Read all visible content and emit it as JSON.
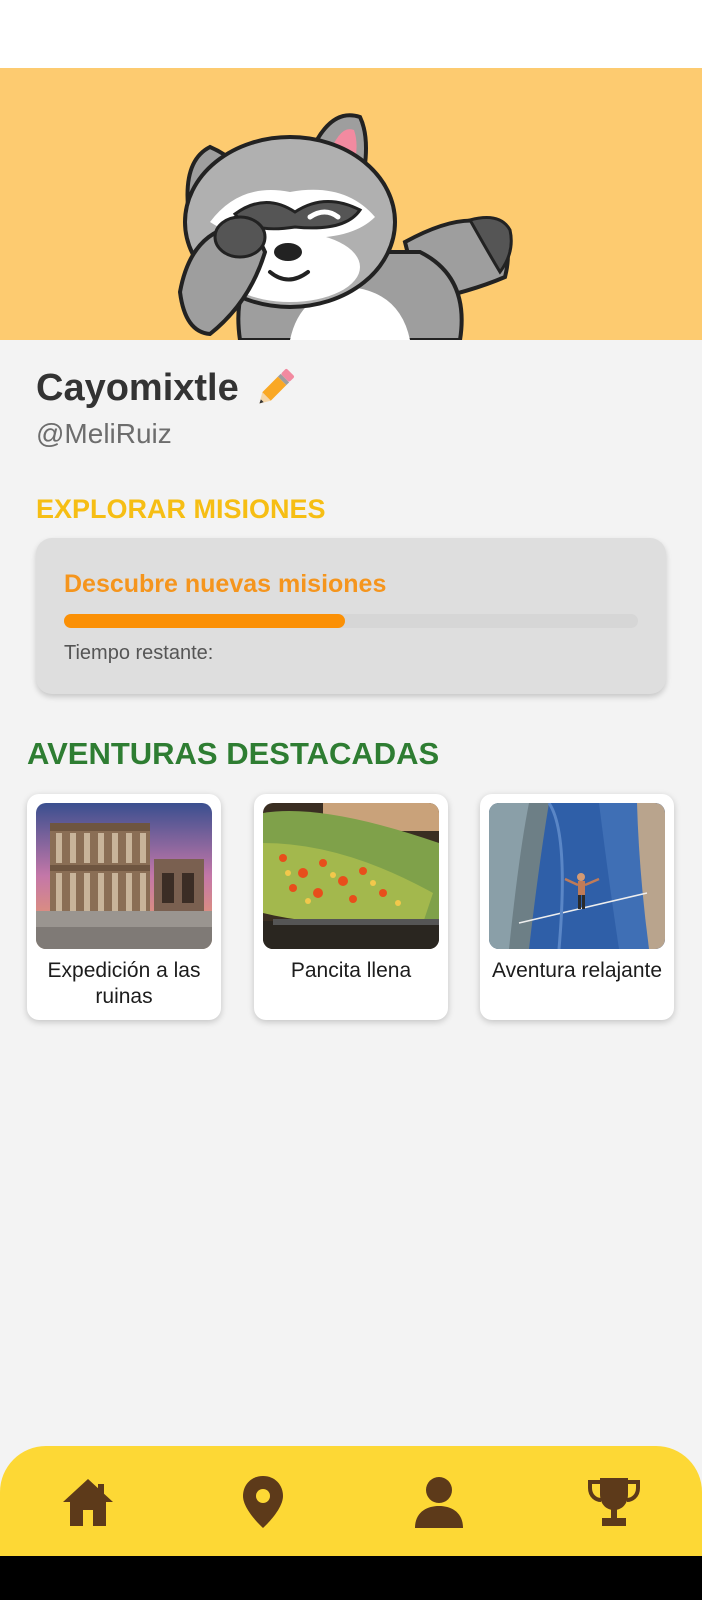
{
  "profile": {
    "name": "Cayomixtle",
    "edit_icon": "pencil-icon",
    "username": "@MeliRuiz"
  },
  "banner": {
    "background_color": "#fdcb70",
    "mascot": "raccoon-dab-illustration"
  },
  "explore": {
    "section_title": "EXPLORAR MISIONES",
    "card_title": "Descubre nuevas misiones",
    "progress": 0.49,
    "time_label": "Tiempo restante:"
  },
  "adventures": {
    "section_title": "AVENTURAS DESTACADAS",
    "items": [
      {
        "label": "Expedición a las ruinas",
        "image": "ancient-library-ruins-photo"
      },
      {
        "label": "Pancita llena",
        "image": "grilled-nopales-food-photo"
      },
      {
        "label": "Aventura relajante",
        "image": "canyon-slackline-photo"
      }
    ]
  },
  "bottom_nav": {
    "items": [
      {
        "icon": "home-icon"
      },
      {
        "icon": "map-pin-icon"
      },
      {
        "icon": "person-icon"
      },
      {
        "icon": "trophy-icon"
      }
    ]
  },
  "colors": {
    "accent_yellow": "#f6be14",
    "accent_orange": "#f5951d",
    "section_green": "#2e7d32",
    "nav_background": "#fdd835",
    "nav_icon": "#5d3a1a"
  }
}
